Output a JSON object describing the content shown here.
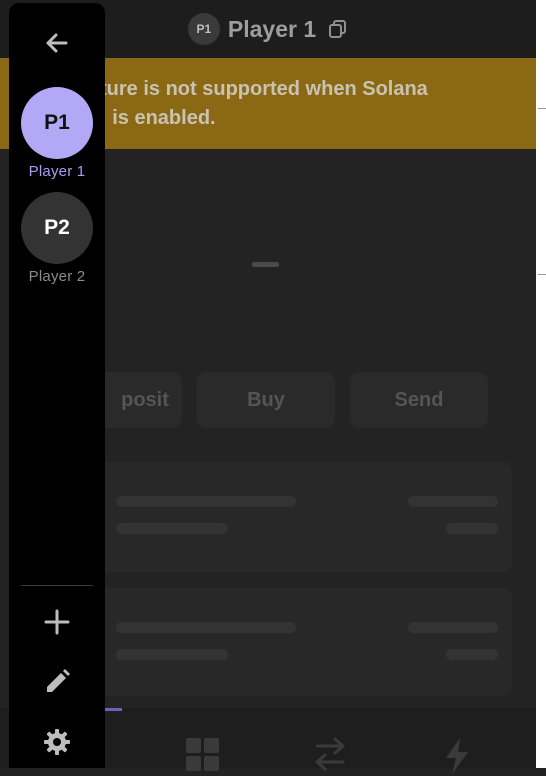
{
  "header": {
    "avatar_text": "P1",
    "title": "Player 1",
    "copy_icon": "copy-icon"
  },
  "banner": {
    "text": "ture is not supported when Solana\n: is enabled."
  },
  "balance": {
    "placeholder": "—"
  },
  "actions": {
    "deposit_label": "posit",
    "buy_label": "Buy",
    "send_label": "Send"
  },
  "tabbar": {
    "icons": [
      "grid-icon",
      "swap-icon",
      "lightning-icon"
    ]
  },
  "sidebar": {
    "back_icon": "arrow-left-icon",
    "players": [
      {
        "initials": "P1",
        "label": "Player 1",
        "selected": true
      },
      {
        "initials": "P2",
        "label": "Player 2",
        "selected": false
      }
    ],
    "actions": [
      "plus-icon",
      "pencil-icon",
      "gear-icon"
    ]
  },
  "colors": {
    "accent": "#b3a8f5",
    "selected_label": "#a99df0",
    "unselected_avatar": "#333333",
    "banner_bg": "#8b6914",
    "sidebar_bg": "#000000"
  }
}
